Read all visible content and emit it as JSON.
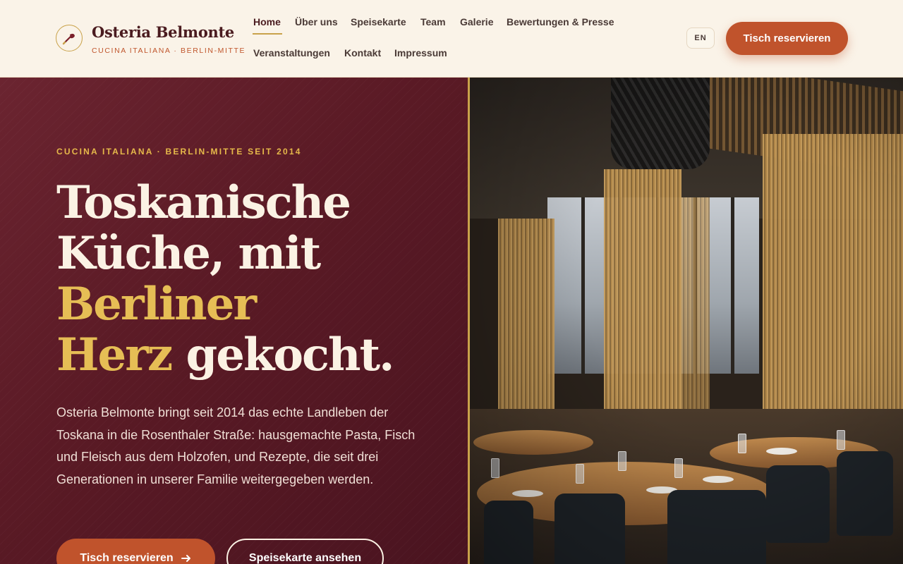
{
  "brand": {
    "name": "Osteria Belmonte",
    "tagline": "CUCINA ITALIANA · BERLIN-MITTE"
  },
  "nav": {
    "items": [
      {
        "label": "Home",
        "active": true
      },
      {
        "label": "Über uns"
      },
      {
        "label": "Speisekarte"
      },
      {
        "label": "Team"
      },
      {
        "label": "Galerie"
      },
      {
        "label": "Bewertungen & Presse"
      },
      {
        "label": "Veranstaltungen"
      },
      {
        "label": "Kontakt"
      },
      {
        "label": "Impressum"
      }
    ]
  },
  "header": {
    "lang_label": "EN",
    "reserve_label": "Tisch reservieren"
  },
  "hero": {
    "eyebrow": "CUCINA ITALIANA · BERLIN-MITTE SEIT 2014",
    "headline": {
      "line1": "Toskanische",
      "line2": "Küche, mit",
      "gold1": "Berliner",
      "gold2": "Herz",
      "end": "gekocht."
    },
    "lead": "Osteria Belmonte bringt seit 2014 das echte Landleben der Toskana in die Rosenthaler Straße: hausgemachte Pasta, Fisch und Fleisch aus dem Holzofen, und Rezepte, die seit drei Generationen in unserer Familie weitergegeben werden.",
    "primary_cta": "Tisch reservieren",
    "secondary_cta": "Speisekarte ansehen"
  },
  "colors": {
    "accent": "#c0532c",
    "gold": "#e6be55",
    "burgundy": "#5a1a25",
    "cream": "#faf3e8"
  },
  "icons": {
    "logo": "pizza-peel-icon",
    "cta_arrow": "arrow-right-icon"
  }
}
